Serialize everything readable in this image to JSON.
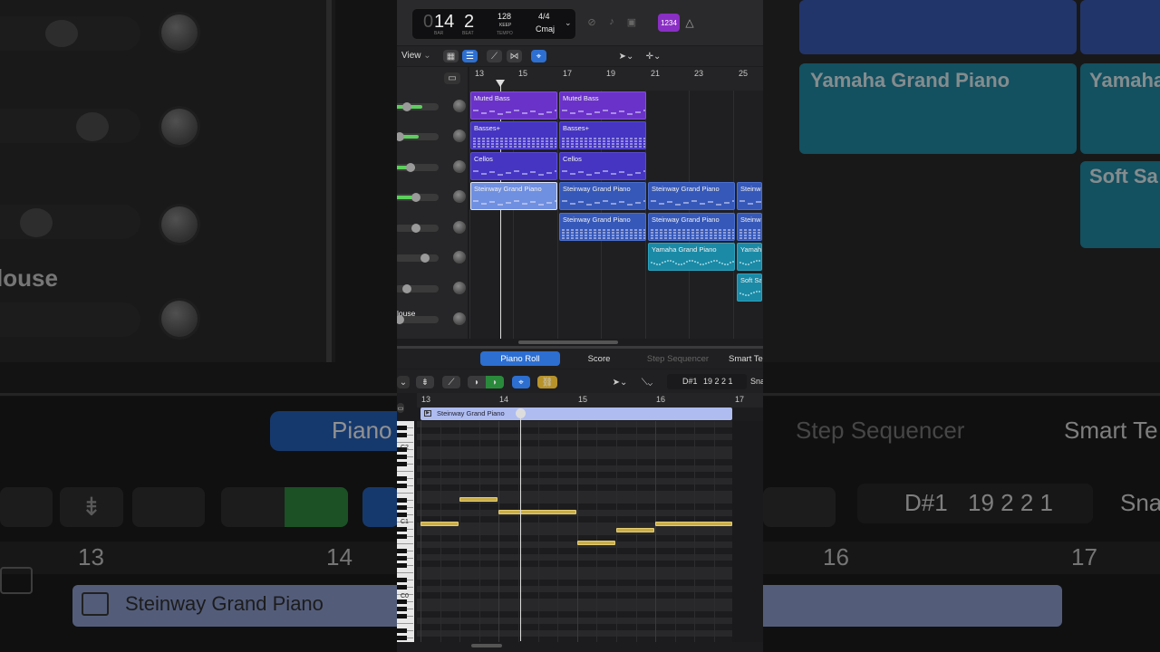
{
  "background_left": {
    "track_label": "louse"
  },
  "background_right": {
    "region1": "Yamaha Grand Piano",
    "region2": "Yamaha",
    "region3": "Soft Sa"
  },
  "background_bottom": {
    "tab_piano": "Piano",
    "tab_step": "Step Sequencer",
    "tab_smart": "Smart Te",
    "pos_key": "D#1",
    "pos_value": "19 2 2 1",
    "snap": "Sna",
    "ruler": [
      "13",
      "14",
      "16",
      "17"
    ],
    "region_label": "Steinway Grand Piano"
  },
  "lcd": {
    "bar": "14",
    "beat": "2",
    "bar_label": "BAR",
    "beat_label": "BEAT",
    "tempo": "128",
    "keep": "KEEP",
    "tempo_label": "TEMPO",
    "signature": "4/4",
    "key": "Cmaj",
    "count_in": "1234"
  },
  "toolbar": {
    "view_label": "View"
  },
  "tracks_ruler": [
    "13",
    "15",
    "17",
    "19",
    "21",
    "23",
    "25"
  ],
  "tracks": [
    {
      "regions": [
        {
          "label": "Muted Bass"
        },
        {
          "label": "Muted Bass"
        }
      ]
    },
    {
      "regions": [
        {
          "label": "Basses+"
        },
        {
          "label": "Basses+"
        }
      ]
    },
    {
      "regions": [
        {
          "label": "Cellos"
        },
        {
          "label": "Cellos"
        }
      ]
    },
    {
      "regions": [
        {
          "label": "Steinway Grand Piano"
        },
        {
          "label": "Steinway Grand Piano"
        },
        {
          "label": "Steinway Grand Piano"
        },
        {
          "label": "Steinwa"
        }
      ]
    },
    {
      "regions": [
        {
          "label": "Steinway Grand Piano"
        },
        {
          "label": "Steinway Grand Piano"
        },
        {
          "label": "Steinwa"
        }
      ]
    },
    {
      "regions": [
        {
          "label": "Yamaha Grand Piano"
        },
        {
          "label": "Yamaha"
        }
      ]
    },
    {
      "regions": [
        {
          "label": "Soft Sa"
        }
      ]
    }
  ],
  "track_name_partial": "louse",
  "editor_tabs": {
    "piano_roll": "Piano Roll",
    "score": "Score",
    "step_sequencer": "Step Sequencer",
    "smart_tempo": "Smart Te"
  },
  "editor_toolbar": {
    "position_key": "D#1",
    "position_value": "19 2 2 1",
    "snap": "Sna"
  },
  "piano_ruler": [
    "13",
    "14",
    "15",
    "16",
    "17"
  ],
  "piano_region": "Steinway Grand Piano",
  "piano_keys": {
    "c2": "C2",
    "c1": "C1",
    "c0": "C0"
  },
  "colors": {
    "accent_blue": "#2d6fd1",
    "note_yellow": "#c9ad4a",
    "count_in_purple": "#8a2fc4"
  }
}
